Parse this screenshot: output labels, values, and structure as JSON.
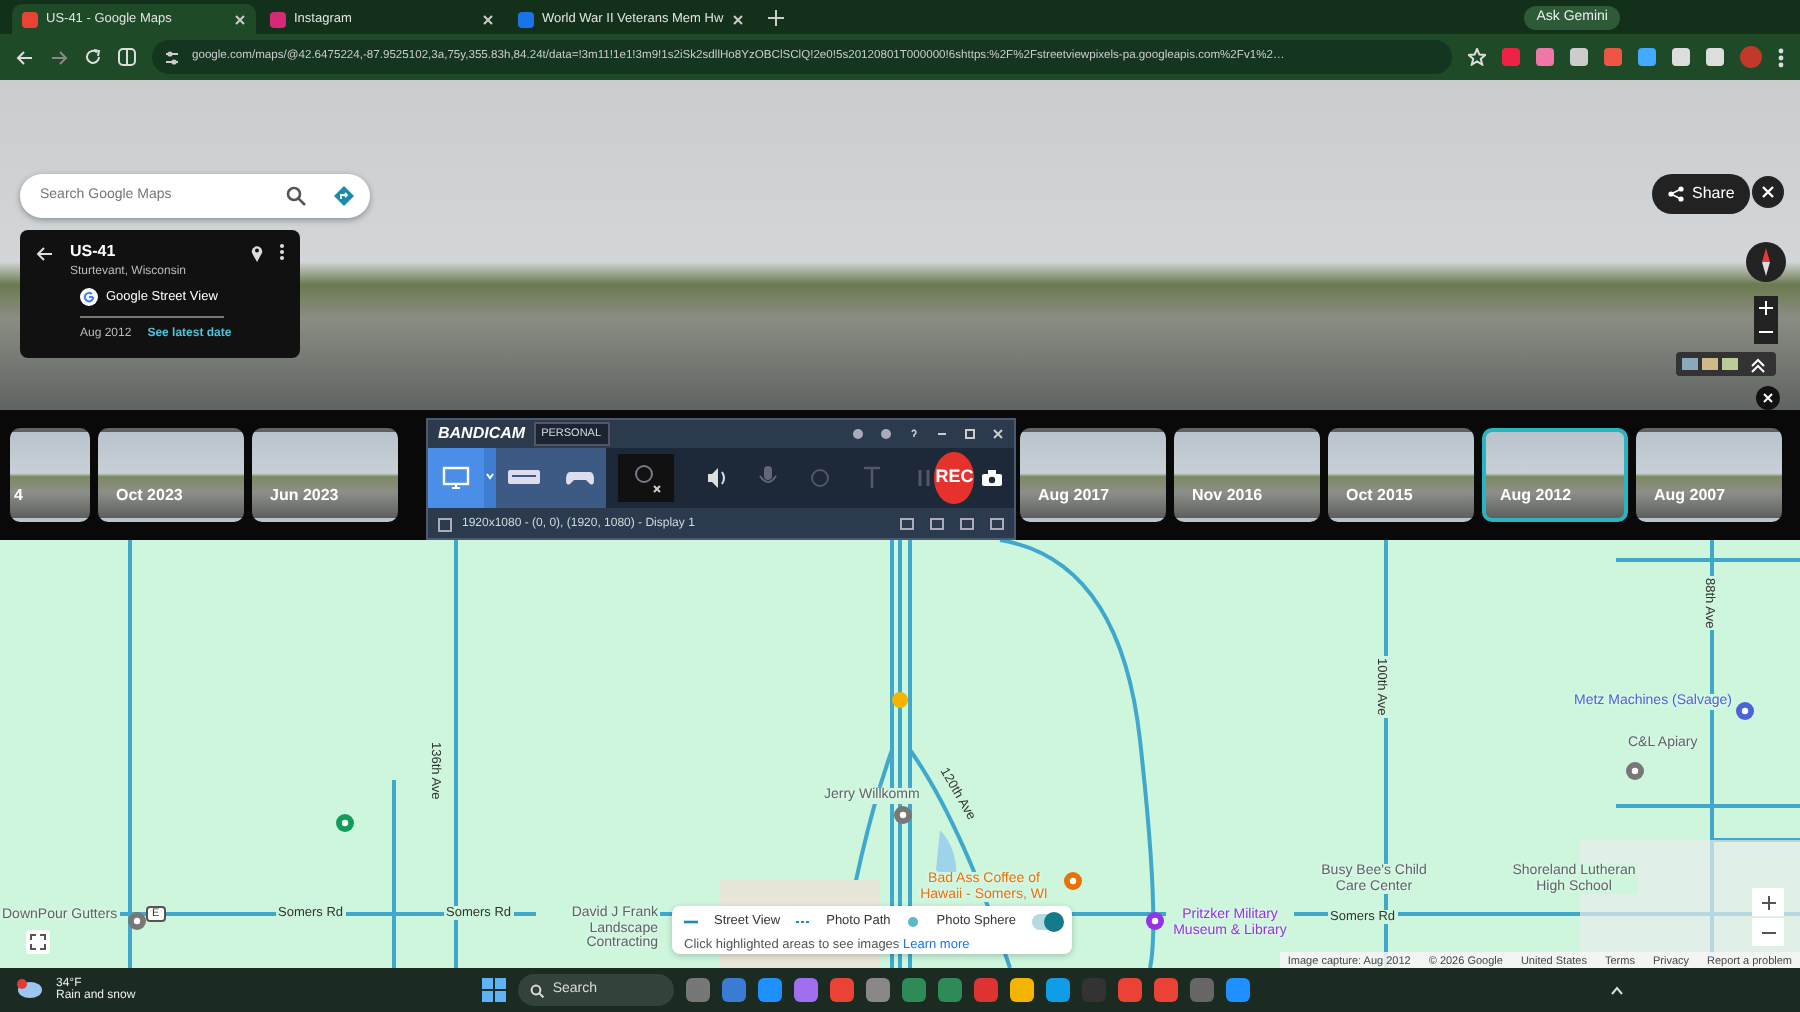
{
  "browser": {
    "tabs": [
      {
        "title": "US-41 - Google Maps",
        "selected": true
      },
      {
        "title": "Instagram",
        "selected": false
      },
      {
        "title": "World War II Veterans Mem Hw",
        "selected": false
      }
    ],
    "ask_gemini": "Ask Gemini",
    "url": "google.com/maps/@42.6475224,-87.9525102,3a,75y,355.83h,84.24t/data=!3m11!1e1!3m9!1s2iSk2sdllHo8YzOBClSClQ!2e0!5s20120801T000000!6shttps:%2F%2Fstreetviewpixels-pa.googleapis.com%2Fv1%2…"
  },
  "street_view": {
    "search": {
      "placeholder": "Search Google Maps"
    },
    "info_card": {
      "title": "US-41",
      "subtitle": "Sturtevant, Wisconsin",
      "source": "Google Street View",
      "date": "Aug 2012",
      "link": "See latest date"
    },
    "share": "Share"
  },
  "timeline": [
    {
      "label": "4",
      "selected": false
    },
    {
      "label": "Oct 2023",
      "selected": false
    },
    {
      "label": "Jun 2023",
      "selected": false
    },
    {
      "label": "Aug 2017",
      "selected": false
    },
    {
      "label": "Nov 2016",
      "selected": false
    },
    {
      "label": "Oct 2015",
      "selected": false
    },
    {
      "label": "Aug 2012",
      "selected": true
    },
    {
      "label": "Aug 2007",
      "selected": false
    }
  ],
  "recorder": {
    "brand": "BANDICAM",
    "edition": "PERSONAL",
    "modes": [
      {
        "kind": "screen",
        "selected": true
      },
      {
        "kind": "device",
        "selected": false
      },
      {
        "kind": "game",
        "selected": false
      }
    ],
    "rec": "REC",
    "region": "1920x1080 - (0, 0), (1920, 1080) - Display 1"
  },
  "map": {
    "labels": [
      {
        "text": "88th Ave",
        "kind": "road_vertical"
      },
      {
        "text": "100th Ave",
        "kind": "road_vertical"
      },
      {
        "text": "Metz Machines (Salvage)",
        "kind": "poi",
        "color": "#4a63d6"
      },
      {
        "text": "C&L Apiary",
        "kind": "poi",
        "color": "#5f6368"
      },
      {
        "text": "136th Ave",
        "kind": "road_vertical"
      },
      {
        "text": "120th Ave",
        "kind": "road_diagonal"
      },
      {
        "text": "Jerry Willkomm",
        "kind": "poi",
        "color": "#5f6368"
      },
      {
        "text": "Bad Ass Coffee of Hawaii - Somers, WI",
        "kind": "poi",
        "color": "#e8710a"
      },
      {
        "text": "Busy Bee's Child Care Center",
        "kind": "poi",
        "color": "#5f6368"
      },
      {
        "text": "Shoreland Lutheran High School",
        "kind": "poi",
        "color": "#5f6368"
      },
      {
        "text": "DownPour Gutters",
        "kind": "poi",
        "color": "#5f6368"
      },
      {
        "text": "E",
        "kind": "shield"
      },
      {
        "text": "Somers Rd",
        "kind": "road"
      },
      {
        "text": "Somers Rd",
        "kind": "road"
      },
      {
        "text": "David J Frank Landscape Contracting",
        "kind": "poi",
        "color": "#5f6368"
      },
      {
        "text": "Pritzker Military Museum & Library",
        "kind": "poi",
        "color": "#9334e6"
      },
      {
        "text": "Somers Rd",
        "kind": "road"
      }
    ],
    "legend": {
      "items": [
        "Street View",
        "Photo Path",
        "Photo Sphere"
      ],
      "hint": "Click highlighted areas to see images",
      "link": "Learn more",
      "on": true
    },
    "attribution": [
      "Image capture: Aug 2012",
      "© 2026 Google",
      "United States",
      "Terms",
      "Privacy",
      "Report a problem"
    ]
  },
  "taskbar": {
    "weather": {
      "temp": "34°F",
      "condition": "Rain and snow"
    },
    "search": "Search"
  }
}
